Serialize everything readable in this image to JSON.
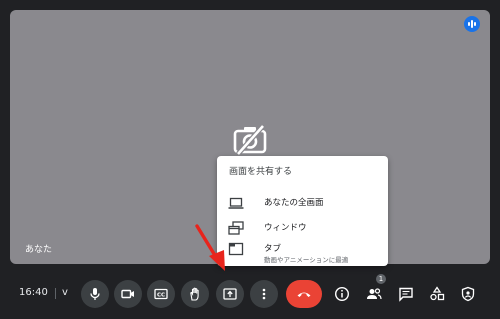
{
  "participant": {
    "name": "あなた"
  },
  "icons": {
    "audio_indicator": "audio-level-icon",
    "camera_off": "camera-off-icon"
  },
  "share_menu": {
    "title": "画面を共有する",
    "items": [
      {
        "icon": "laptop-icon",
        "label": "あなたの全画面",
        "sub": ""
      },
      {
        "icon": "window-icon",
        "label": "ウィンドウ",
        "sub": ""
      },
      {
        "icon": "tab-icon",
        "label": "タブ",
        "sub": "動画やアニメーションに最適"
      }
    ]
  },
  "bottom_bar": {
    "time": "16:40",
    "meeting_code": "v",
    "people_count": "1",
    "controls": [
      "mic-icon",
      "camera-icon",
      "captions-icon",
      "raise-hand-icon",
      "present-icon",
      "more-options-icon",
      "hangup-icon",
      "info-icon",
      "people-icon",
      "chat-icon",
      "activities-icon",
      "host-controls-icon"
    ]
  },
  "colors": {
    "background": "#202124",
    "tile": "#8a898e",
    "control": "#3c4043",
    "hangup": "#ea4335",
    "accent": "#1a73e8",
    "annotation_arrow": "#e8241c"
  }
}
